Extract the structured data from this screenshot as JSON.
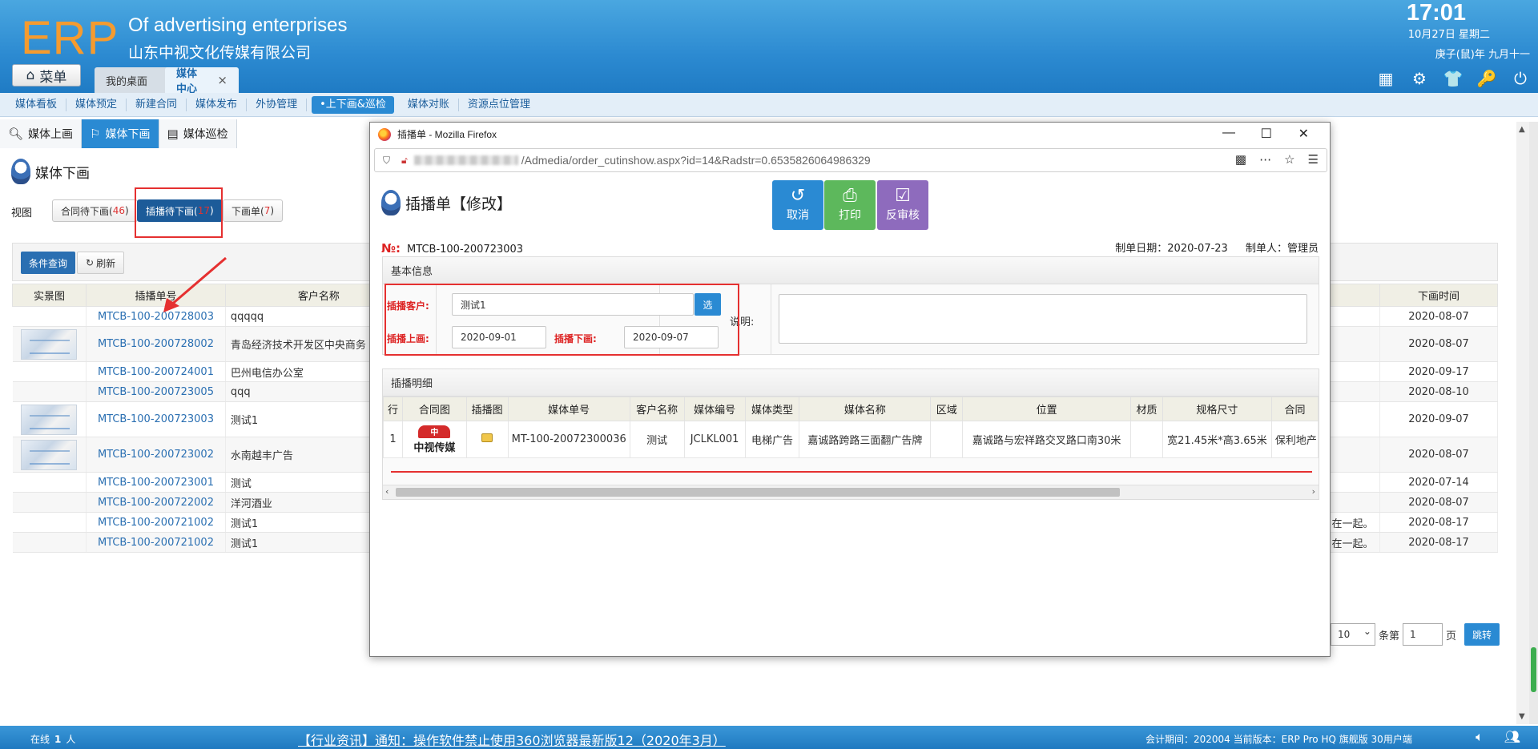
{
  "header": {
    "logo": "ERP",
    "company_en": "Of advertising enterprises",
    "company_cn": "山东中视文化传媒有限公司",
    "time": "17:01",
    "date": "10月27日 星期二",
    "lunar": "庚子(鼠)年 九月十一",
    "menu_label": "菜单",
    "tabs": [
      {
        "label": "我的桌面"
      },
      {
        "label": "媒体中心",
        "close": "×"
      }
    ]
  },
  "nav": {
    "items": [
      "媒体看板",
      "媒体预定",
      "新建合同",
      "媒体发布",
      "外协管理",
      "•上下画&巡检",
      "媒体对账",
      "资源点位管理"
    ]
  },
  "subtabs": [
    "媒体上画",
    "媒体下画",
    "媒体巡检"
  ],
  "page": {
    "title": "媒体下画",
    "view_label": "视图",
    "views": [
      {
        "label": "合同待下画(",
        "count": "46",
        "suffix": ")"
      },
      {
        "label": "插播待下画(",
        "count": "17",
        "suffix": ")"
      },
      {
        "label": "下画单(",
        "count": "7",
        "suffix": ")"
      }
    ],
    "toolbar": {
      "query": "条件查询",
      "refresh": "刷新"
    },
    "columns": {
      "photo": "实景图",
      "order_no": "插播单号",
      "customer": "客户名称",
      "end_time": "下画时间"
    },
    "rows": [
      {
        "order_no": "MTCB-100-200728003",
        "customer": "qqqqq",
        "tail": "",
        "date": "2020-08-07",
        "thumb": false
      },
      {
        "order_no": "MTCB-100-200728002",
        "customer": "青岛经济技术开发区中央商务",
        "tail": "",
        "date": "2020-08-07",
        "thumb": true
      },
      {
        "order_no": "MTCB-100-200724001",
        "customer": "巴州电信办公室",
        "tail": "",
        "date": "2020-09-17",
        "thumb": false
      },
      {
        "order_no": "MTCB-100-200723005",
        "customer": "qqq",
        "tail": "",
        "date": "2020-08-10",
        "thumb": false
      },
      {
        "order_no": "MTCB-100-200723003",
        "customer": "测试1",
        "tail": "",
        "date": "2020-09-07",
        "thumb": true
      },
      {
        "order_no": "MTCB-100-200723002",
        "customer": "水南越丰广告",
        "tail": "",
        "date": "2020-08-07",
        "thumb": true
      },
      {
        "order_no": "MTCB-100-200723001",
        "customer": "测试",
        "tail": "",
        "date": "2020-07-14",
        "thumb": false
      },
      {
        "order_no": "MTCB-100-200722002",
        "customer": "洋河酒业",
        "tail": "",
        "date": "2020-08-07",
        "thumb": false
      },
      {
        "order_no": "MTCB-100-200721002",
        "customer": "测试1",
        "tail": "在一起。",
        "date": "2020-08-17",
        "thumb": false
      },
      {
        "order_no": "MTCB-100-200721002",
        "customer": "测试1",
        "tail": "在一起。",
        "date": "2020-08-17",
        "thumb": false
      }
    ],
    "pager": {
      "prefix": "页",
      "page_size": "10",
      "goto_label": "条第",
      "page": "1",
      "page_suffix": "页",
      "go": "跳转"
    }
  },
  "popup": {
    "window_title": "插播单 - Mozilla Firefox",
    "url": "/Admedia/order_cutinshow.aspx?id=14&Radstr=0.6535826064986329",
    "heading": "插播单【修改】",
    "buttons": {
      "cancel": "取消",
      "print": "打印",
      "audit": "反审核"
    },
    "doc_no_label": "№:",
    "doc_no": "MTCB-100-200723003",
    "doc_date": "制单日期：2020-07-23",
    "doc_maker": "制单人：管理员",
    "basic": {
      "section_title": "基本信息",
      "customer_label": "插播客户:",
      "customer_value": "测试1",
      "select_btn": "选",
      "start_label": "插播上画:",
      "start_value": "2020-09-01",
      "end_label": "插播下画:",
      "end_value": "2020-09-07",
      "remark_label": "说明:"
    },
    "detail": {
      "section_title": "插播明细",
      "columns": [
        "行",
        "合同图",
        "插播图",
        "媒体单号",
        "客户名称",
        "媒体编号",
        "媒体类型",
        "媒体名称",
        "区域",
        "位置",
        "材质",
        "规格尺寸",
        "合同"
      ],
      "row": {
        "line": "1",
        "contract_logo": "中视传媒",
        "media_order": "MT-100-20072300036",
        "customer": "测试",
        "media_code": "JCLKL001",
        "media_type": "电梯广告",
        "media_name": "嘉诚路跨路三面翻广告牌",
        "region": "",
        "position": "嘉诚路与宏祥路交叉路口南30米",
        "material": "",
        "size": "宽21.45米*高3.65米",
        "contract": "保利地产"
      }
    }
  },
  "status": {
    "online_label": "在线",
    "online_count": "1",
    "online_unit": "人",
    "news": "【行业资讯】通知：操作软件禁止使用360浏览器最新版12（2020年3月）",
    "accounting": "会计期间：202004 当前版本：ERP Pro HQ 旗舰版 30用户端"
  },
  "colors": {
    "header": "#2c8ad1",
    "accent": "#2a8ad3",
    "logo": "#f59b2f",
    "highlight": "#e53030"
  }
}
